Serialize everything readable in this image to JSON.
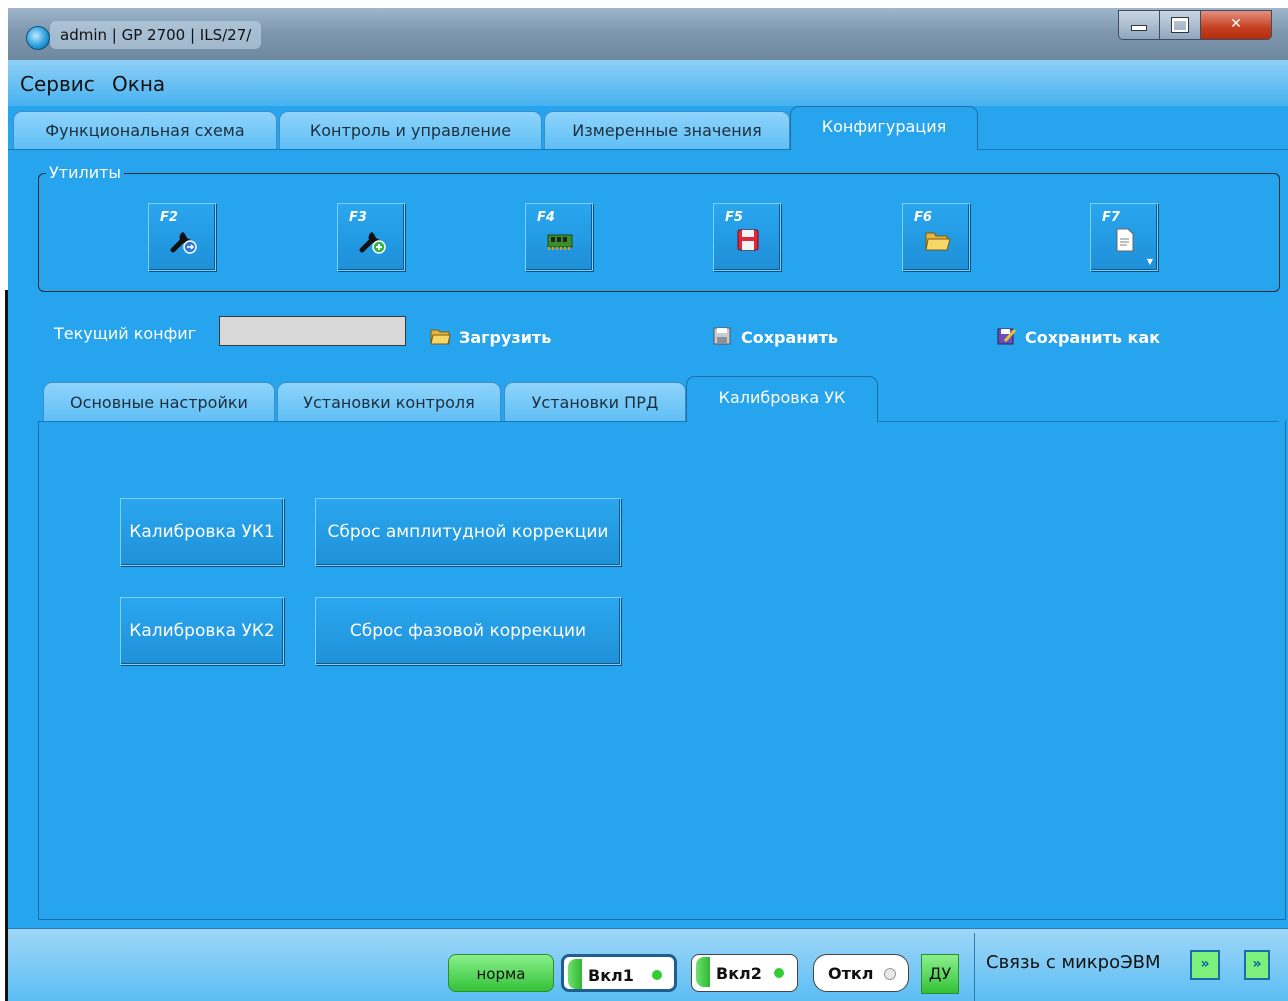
{
  "window": {
    "title": "admin | GP 2700 | ILS/27/"
  },
  "menu": {
    "items": [
      "Сервис",
      "Окна"
    ]
  },
  "tabs": [
    {
      "label": "Функциональная схема"
    },
    {
      "label": "Контроль и управление"
    },
    {
      "label": "Измеренные значения"
    },
    {
      "label": "Конфигурация",
      "active": true
    }
  ],
  "utilities": {
    "title": "Утилиты",
    "buttons": [
      {
        "key": "F2",
        "icon": "wrench-arrow-icon"
      },
      {
        "key": "F3",
        "icon": "wrench-add-icon"
      },
      {
        "key": "F4",
        "icon": "memory-chip-icon"
      },
      {
        "key": "F5",
        "icon": "save-disk-icon"
      },
      {
        "key": "F6",
        "icon": "folder-open-icon"
      },
      {
        "key": "F7",
        "icon": "document-icon"
      }
    ]
  },
  "config": {
    "current_label": "Текущий конфиг",
    "current_value": "",
    "load_label": "Загрузить",
    "save_label": "Сохранить",
    "save_as_label": "Сохранить как"
  },
  "subtabs": [
    {
      "label": "Основные настройки"
    },
    {
      "label": "Установки контроля"
    },
    {
      "label": "Установки ПРД"
    },
    {
      "label": "Калибровка УК",
      "active": true
    }
  ],
  "calibration": {
    "cal1": "Калибровка УК1",
    "cal2": "Калибровка УК2",
    "reset_amp": "Сброс амплитудной коррекции",
    "reset_phase": "Сброс фазовой коррекции"
  },
  "status": {
    "norma": "норма",
    "vkl1": "Вкл1",
    "vkl2": "Вкл2",
    "otkl": "Откл",
    "du": "ДУ",
    "link_label": "Связь с микроЭВМ"
  },
  "colors": {
    "background": "#26a4ee",
    "led_on": "#33cc33",
    "led_off": "#e0e0e0"
  }
}
